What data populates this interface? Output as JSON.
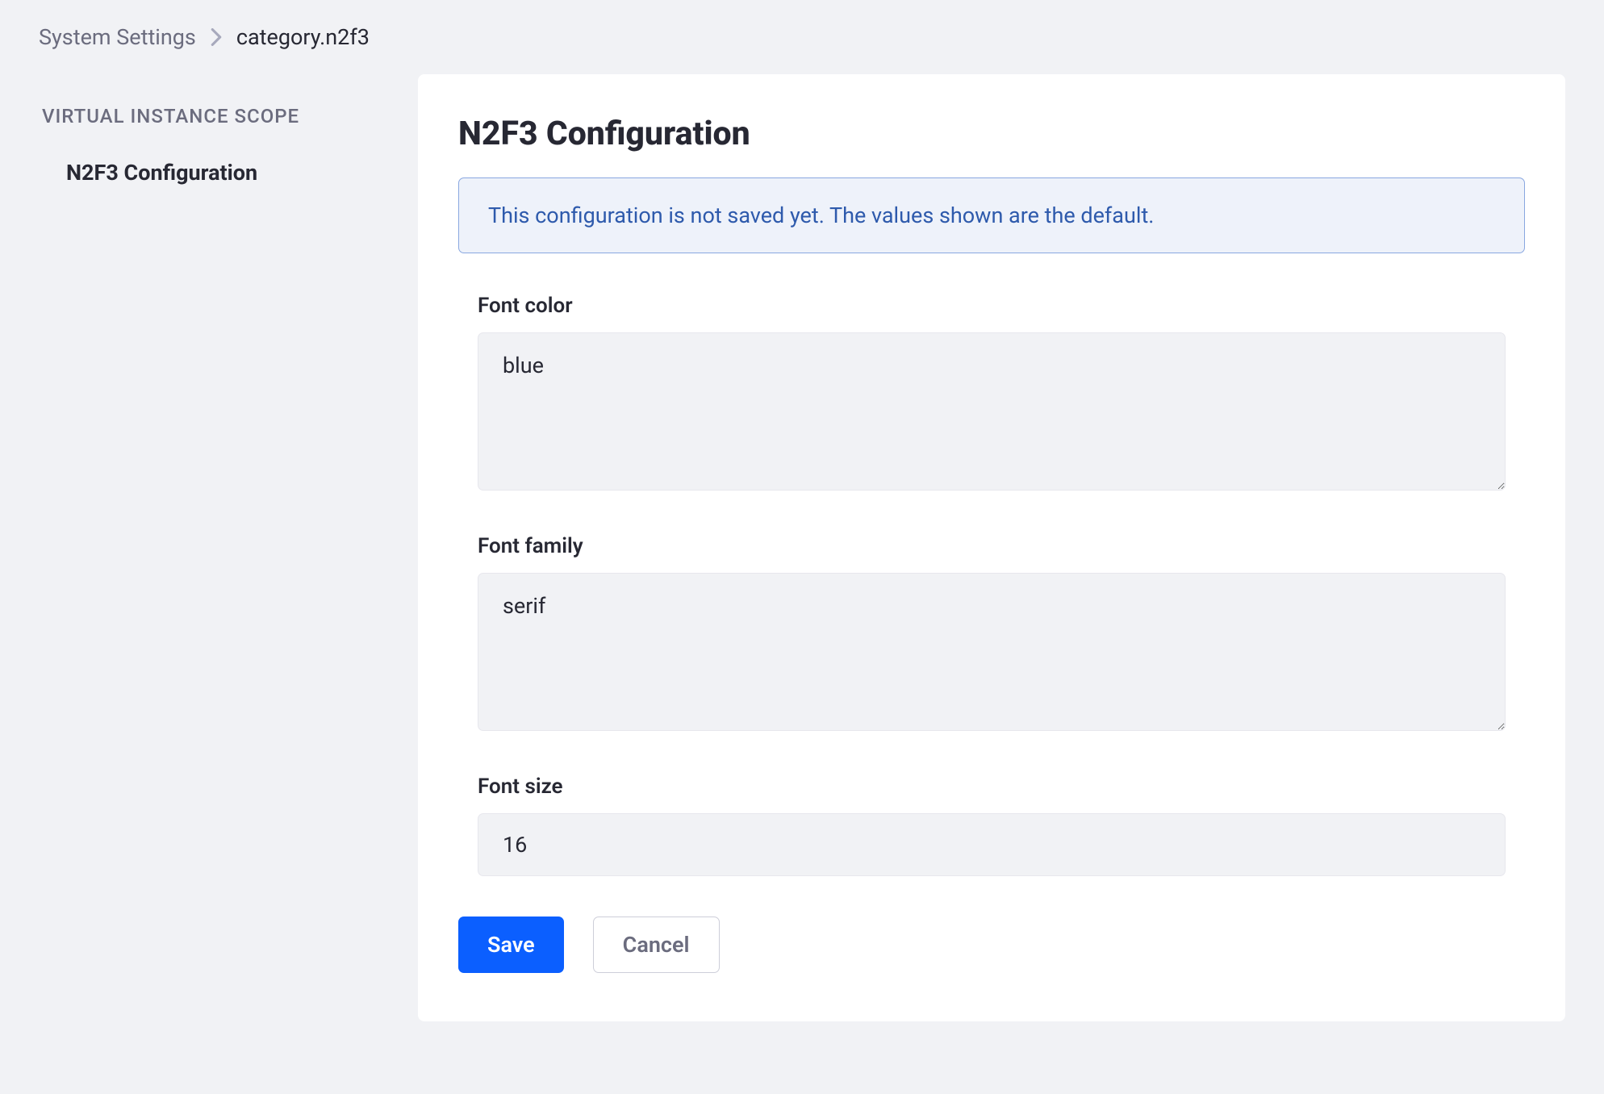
{
  "breadcrumb": {
    "parent": "System Settings",
    "current": "category.n2f3"
  },
  "sidebar": {
    "heading": "VIRTUAL INSTANCE SCOPE",
    "items": [
      {
        "label": "N2F3 Configuration",
        "active": true
      }
    ]
  },
  "main": {
    "title": "N2F3 Configuration",
    "alert": "This configuration is not saved yet. The values shown are the default.",
    "fields": {
      "fontColor": {
        "label": "Font color",
        "value": "blue"
      },
      "fontFamily": {
        "label": "Font family",
        "value": "serif"
      },
      "fontSize": {
        "label": "Font size",
        "value": "16"
      }
    },
    "buttons": {
      "save": "Save",
      "cancel": "Cancel"
    }
  }
}
